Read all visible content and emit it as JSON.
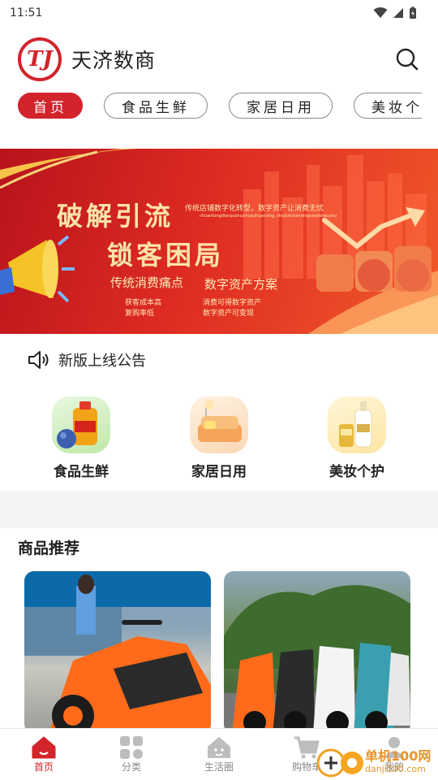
{
  "status_bar": {
    "time": "11:51"
  },
  "app": {
    "title": "天济数商",
    "logo_text": "TJ"
  },
  "tabs": [
    {
      "label": "首页"
    },
    {
      "label": "食品生鲜"
    },
    {
      "label": "家居日用"
    },
    {
      "label": "美妆个护"
    }
  ],
  "banner": {
    "headline1": "破解引流",
    "headline2": "锁客困局",
    "tagline": "传统店铺数字化转型，数字资产让消费无忧",
    "pinyin": "chuantongdianpushuzihuazhuanxing, shuzizichanrangxiaofeiwuyou",
    "left_sub": "传统消费痛点",
    "right_sub": "数字资产方案",
    "left_points": [
      "获客成本高",
      "复购率低"
    ],
    "right_points": [
      "消费可得数字资产",
      "数字资产可变现"
    ]
  },
  "notice": {
    "text": "新版上线公告"
  },
  "categories": [
    {
      "label": "食品生鲜",
      "icon": "oil-bottle-icon"
    },
    {
      "label": "家居日用",
      "icon": "sofa-icon"
    },
    {
      "label": "美妆个护",
      "icon": "shampoo-icon"
    }
  ],
  "recommend": {
    "title": "商品推荐"
  },
  "bottom_nav": [
    {
      "label": "首页",
      "icon": "home-icon"
    },
    {
      "label": "分类",
      "icon": "grid-icon"
    },
    {
      "label": "生活圈",
      "icon": "house-face-icon"
    },
    {
      "label": "购物车",
      "icon": "cart-icon"
    },
    {
      "label": "我的",
      "icon": "user-icon"
    }
  ],
  "watermark": {
    "text": "单机100网",
    "url": "danji100.com"
  },
  "colors": {
    "accent": "#d3232b",
    "nav_inactive": "#888888",
    "band": "#f4f4f4"
  }
}
